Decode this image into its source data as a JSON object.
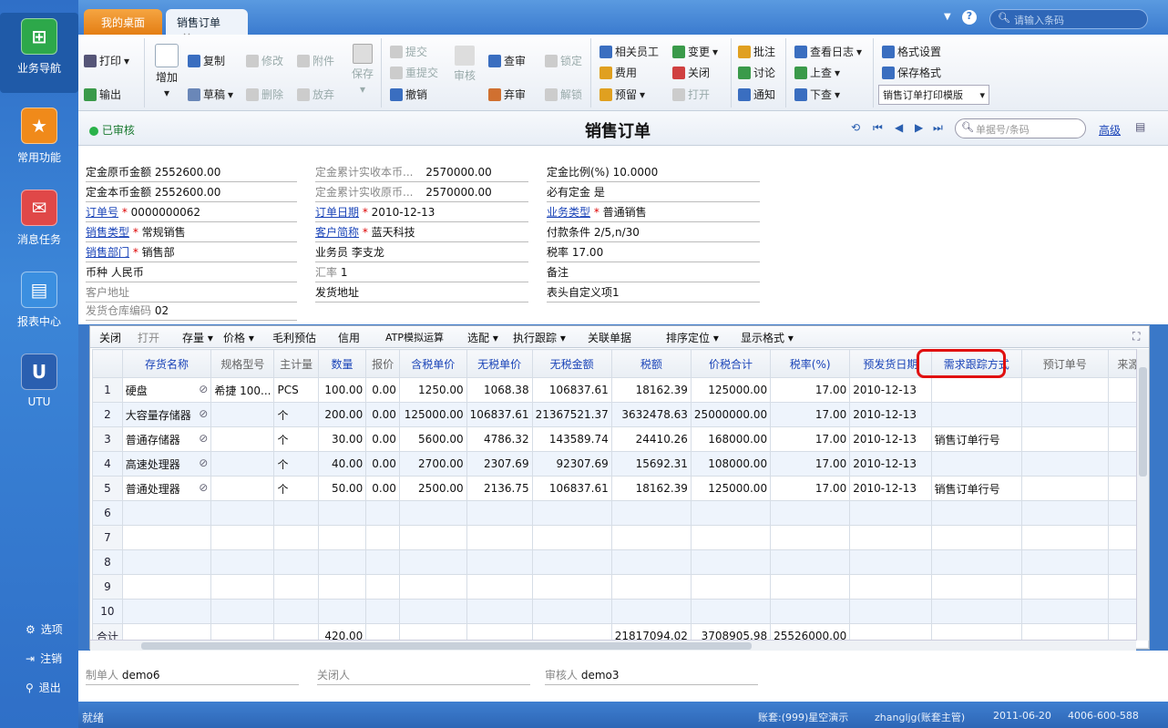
{
  "nav": {
    "items": [
      {
        "label": "业务导航"
      },
      {
        "label": "常用功能"
      },
      {
        "label": "消息任务"
      },
      {
        "label": "报表中心"
      },
      {
        "label": "UTU"
      }
    ],
    "bottom": {
      "options": "选项",
      "logout": "注销",
      "exit": "退出"
    }
  },
  "tabs": [
    {
      "label": "我的桌面"
    },
    {
      "label": "销售订单"
    }
  ],
  "search": {
    "placeholder": "请输入条码"
  },
  "toolbar": {
    "print": "打印",
    "output": "输出",
    "add": "增加",
    "copy": "复制",
    "draft": "草稿",
    "edit": "修改",
    "delete": "删除",
    "attach": "附件",
    "abandon": "放弃",
    "save": "保存",
    "submit": "提交",
    "resubmit": "重提交",
    "revoke": "撤销",
    "audit": "审核",
    "check": "查审",
    "discard": "弃审",
    "lock": "锁定",
    "unlock": "解锁",
    "staff": "相关员工",
    "fee": "费用",
    "reserve": "预留",
    "change": "变更",
    "close": "关闭",
    "open": "打开",
    "note": "批注",
    "discuss": "讨论",
    "notify": "通知",
    "log": "查看日志",
    "prev": "上查",
    "next": "下查",
    "fmt_set": "格式设置",
    "fmt_save": "保存格式",
    "template": "销售订单打印模版"
  },
  "title": {
    "status": "已审核",
    "text": "销售订单",
    "docsearch": "单据号/条码",
    "advanced": "高级"
  },
  "form": {
    "f1l": "定金原币金额",
    "f1v": "2552600.00",
    "f2l": "定金累计实收本币...",
    "f2v": "2570000.00",
    "f3l": "定金比例(%)",
    "f3v": "10.0000",
    "f4l": "定金本币金额",
    "f4v": "2552600.00",
    "f5l": "定金累计实收原币...",
    "f5v": "2570000.00",
    "f6l": "必有定金",
    "f6v": "是",
    "f7l": "订单号",
    "f7v": "0000000062",
    "f8l": "订单日期",
    "f8v": "2010-12-13",
    "f9l": "业务类型",
    "f9v": "普通销售",
    "f10l": "销售类型",
    "f10v": "常规销售",
    "f11l": "客户简称",
    "f11v": "蓝天科技",
    "f12l": "付款条件",
    "f12v": "2/5,n/30",
    "f13l": "销售部门",
    "f13v": "销售部",
    "f14l": "业务员",
    "f14v": "李支龙",
    "f15l": "税率",
    "f15v": "17.00",
    "f16l": "币种",
    "f16v": "人民币",
    "f17l": "汇率",
    "f17v": "1",
    "f18l": "备注",
    "f18v": "",
    "f19l": "客户地址",
    "f20l": "发货地址",
    "f21l": "表头自定义项1",
    "f22l": "发货仓库编码",
    "f22v": "02",
    "req": "*"
  },
  "gridtb": {
    "close": "关闭",
    "open": "打开",
    "stock": "存量",
    "price": "价格",
    "profit": "毛利预估",
    "credit": "信用",
    "atp": "ATP模拟运算",
    "pick": "选配",
    "track": "执行跟踪",
    "rel": "关联单据",
    "sort": "排序定位",
    "fmt": "显示格式"
  },
  "grid": {
    "headers": [
      "存货名称",
      "规格型号",
      "主计量",
      "数量",
      "报价",
      "含税单价",
      "无税单价",
      "无税金额",
      "税额",
      "价税合计",
      "税率(%)",
      "预发货日期",
      "需求跟踪方式",
      "预订单号",
      "来源"
    ],
    "rows": [
      [
        "1",
        "硬盘",
        "希捷 100...",
        "PCS",
        "100.00",
        "0.00",
        "1250.00",
        "1068.38",
        "106837.61",
        "18162.39",
        "125000.00",
        "17.00",
        "2010-12-13",
        "",
        ""
      ],
      [
        "2",
        "大容量存储器",
        "",
        "个",
        "200.00",
        "0.00",
        "125000.00",
        "106837.61",
        "21367521.37",
        "3632478.63",
        "25000000.00",
        "17.00",
        "2010-12-13",
        "",
        ""
      ],
      [
        "3",
        "普通存储器",
        "",
        "个",
        "30.00",
        "0.00",
        "5600.00",
        "4786.32",
        "143589.74",
        "24410.26",
        "168000.00",
        "17.00",
        "2010-12-13",
        "销售订单行号",
        ""
      ],
      [
        "4",
        "高速处理器",
        "",
        "个",
        "40.00",
        "0.00",
        "2700.00",
        "2307.69",
        "92307.69",
        "15692.31",
        "108000.00",
        "17.00",
        "2010-12-13",
        "",
        ""
      ],
      [
        "5",
        "普通处理器",
        "",
        "个",
        "50.00",
        "0.00",
        "2500.00",
        "2136.75",
        "106837.61",
        "18162.39",
        "125000.00",
        "17.00",
        "2010-12-13",
        "销售订单行号",
        ""
      ],
      [
        "6",
        "",
        "",
        "",
        "",
        "",
        "",
        "",
        "",
        "",
        "",
        "",
        "",
        "",
        ""
      ],
      [
        "7",
        "",
        "",
        "",
        "",
        "",
        "",
        "",
        "",
        "",
        "",
        "",
        "",
        "",
        ""
      ],
      [
        "8",
        "",
        "",
        "",
        "",
        "",
        "",
        "",
        "",
        "",
        "",
        "",
        "",
        "",
        ""
      ],
      [
        "9",
        "",
        "",
        "",
        "",
        "",
        "",
        "",
        "",
        "",
        "",
        "",
        "",
        "",
        ""
      ],
      [
        "10",
        "",
        "",
        "",
        "",
        "",
        "",
        "",
        "",
        "",
        "",
        "",
        "",
        "",
        ""
      ]
    ],
    "total": {
      "label": "合计",
      "qty": "420.00",
      "amount": "21817094.02",
      "tax": "3708905.98",
      "sum": "25526000.00"
    }
  },
  "footer": {
    "maker_l": "制单人",
    "maker_v": "demo6",
    "closer_l": "关闭人",
    "auditor_l": "审核人",
    "auditor_v": "demo3"
  },
  "status": {
    "left": "就绪",
    "acct": "账套:(999)星空演示",
    "user": "zhangljg(账套主管)",
    "date": "2011-06-20",
    "phone": "4006-600-588"
  },
  "colors": {
    "accent": "#3a78c8",
    "highlight": "#e01010",
    "link": "#1a44b8"
  }
}
